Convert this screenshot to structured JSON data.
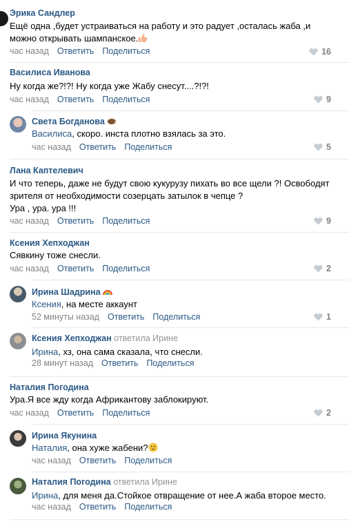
{
  "comments": [
    {
      "author": "Эрика Сандлер",
      "lines": [
        "Ещё одна ,будет устраиваться на работу и это радует ,осталась жаба ,и",
        "можно открывать шампанское."
      ],
      "time": "час назад",
      "reply_label": "Ответить",
      "share_label": "Поделиться",
      "likes": "16"
    },
    {
      "author": "Василиса Иванова",
      "lines": [
        "Ну когда же?!?! Ну когда уже Жабу снесут....?!?!"
      ],
      "time": "час назад",
      "reply_label": "Ответить",
      "share_label": "Поделиться",
      "likes": "9"
    },
    {
      "author": "Света Богданова",
      "mention": "Василиса",
      "lines": [
        ", скоро. инста плотно взялась за это."
      ],
      "time": "час назад",
      "reply_label": "Ответить",
      "share_label": "Поделиться",
      "likes": "5"
    },
    {
      "author": "Лана Каптелевич",
      "lines": [
        "И что теперь, даже не будут свою кукурузу пихать во все щели ?! Освободят",
        "зрителя от необходимости созерцать затылок в чепце ?",
        "Ура , ура. ура !!!"
      ],
      "time": "час назад",
      "reply_label": "Ответить",
      "share_label": "Поделиться",
      "likes": "9"
    },
    {
      "author": "Ксения Хепходжан",
      "lines": [
        "Сявкину тоже снесли."
      ],
      "time": "час назад",
      "reply_label": "Ответить",
      "share_label": "Поделиться",
      "likes": "2"
    },
    {
      "author": "Ирина Шадрина",
      "mention": "Ксения",
      "lines": [
        ", на месте аккаунт"
      ],
      "time": "52 минуты назад",
      "reply_label": "Ответить",
      "share_label": "Поделиться",
      "likes": "1"
    },
    {
      "author": "Ксения Хепходжан",
      "author_extra": "ответила Ирине",
      "mention": "Ирина",
      "lines": [
        ", хз, она сама сказала, что снесли."
      ],
      "time": "28 минут назад",
      "reply_label": "Ответить",
      "share_label": "Поделиться",
      "likes": ""
    },
    {
      "author": "Наталия Погодина",
      "lines": [
        "Ура.Я все жду когда Африкантову заблокируют."
      ],
      "time": "час назад",
      "reply_label": "Ответить",
      "share_label": "Поделиться",
      "likes": "2"
    },
    {
      "author": "Ирина Якунина",
      "mention": "Наталия",
      "lines": [
        ", она хуже жабени?"
      ],
      "time": "час назад",
      "reply_label": "Ответить",
      "share_label": "Поделиться",
      "likes": ""
    },
    {
      "author": "Наталия Погодина",
      "author_extra": "ответила Ирине",
      "mention": "Ирина",
      "lines": [
        ", для меня да.Стойкое отвращение от нее.А жаба второе место."
      ],
      "time": "час назад",
      "reply_label": "Ответить",
      "share_label": "Поделиться",
      "likes": ""
    }
  ],
  "colors": {
    "link": "#2a5885",
    "meta": "#828282",
    "separator": "#e7e8ec"
  },
  "icons": {
    "like": "heart-icon",
    "emoji_1": "thumbs-up-emoji",
    "emoji_2": "thinking-face-emoji",
    "emoji_3": "hedgehog-emoji",
    "emoji_4": "rainbow-emoji"
  }
}
